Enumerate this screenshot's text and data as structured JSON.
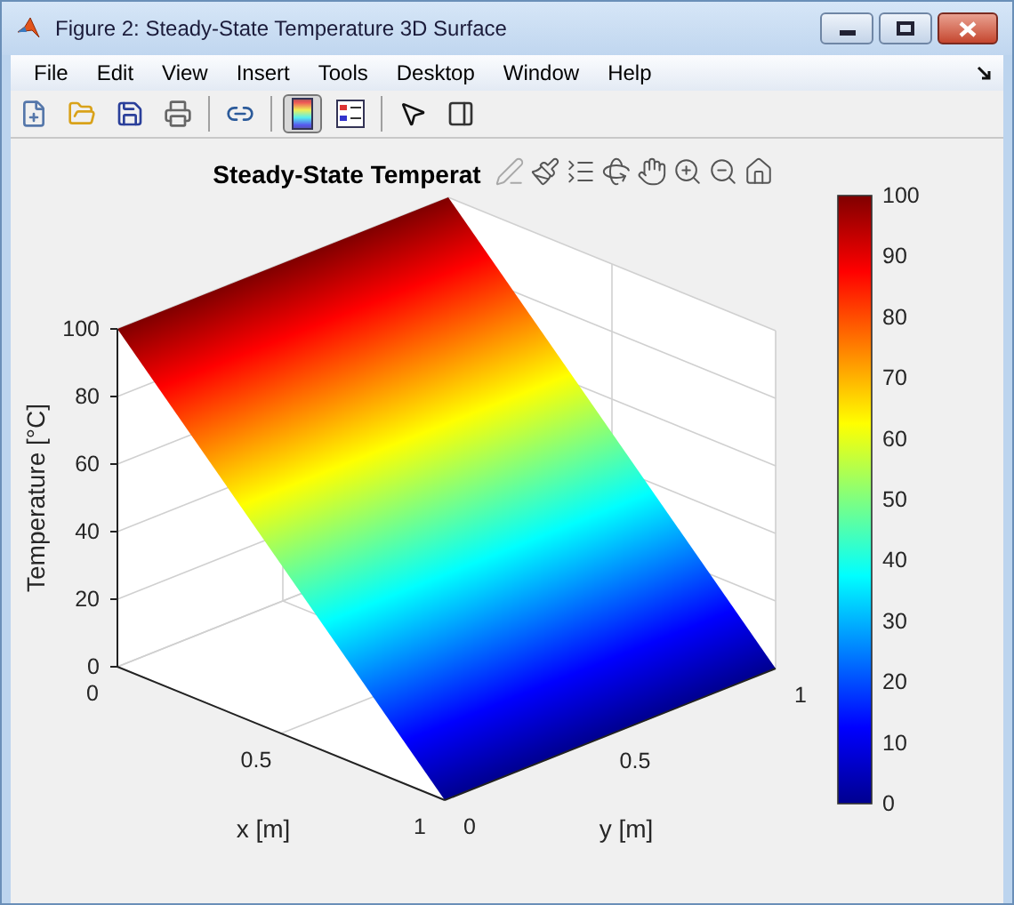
{
  "window": {
    "title": "Figure 2: Steady-State Temperature 3D Surface"
  },
  "menu": [
    "File",
    "Edit",
    "View",
    "Insert",
    "Tools",
    "Desktop",
    "Window",
    "Help"
  ],
  "toolbar": [
    {
      "kind": "new",
      "selected": false
    },
    {
      "kind": "open",
      "selected": false
    },
    {
      "kind": "save",
      "selected": false
    },
    {
      "kind": "print",
      "selected": false
    },
    {
      "kind": "separator"
    },
    {
      "kind": "link",
      "selected": false
    },
    {
      "kind": "separator"
    },
    {
      "kind": "colorbar",
      "selected": true
    },
    {
      "kind": "legend",
      "selected": false
    },
    {
      "kind": "separator"
    },
    {
      "kind": "pointer",
      "selected": false
    },
    {
      "kind": "property_editor",
      "selected": false
    }
  ],
  "axes_toolbar": [
    {
      "kind": "edit"
    },
    {
      "kind": "brush"
    },
    {
      "kind": "legend"
    },
    {
      "kind": "rotate"
    },
    {
      "kind": "pan"
    },
    {
      "kind": "zoom_in"
    },
    {
      "kind": "zoom_out"
    },
    {
      "kind": "home"
    }
  ],
  "plot": {
    "title": "Steady-State Temperat",
    "zlabel": "Temperature [°C]",
    "xlabel": "x [m]",
    "ylabel": "y [m]",
    "zticks": [
      "100",
      "80",
      "60",
      "40",
      "20",
      "0"
    ],
    "xticks": [
      "0",
      "0.5",
      "1"
    ],
    "yticks": [
      "0",
      "0.5",
      "1"
    ],
    "colorbar_ticks": [
      "100",
      "90",
      "80",
      "70",
      "60",
      "50",
      "40",
      "30",
      "20",
      "10",
      "0"
    ]
  }
}
